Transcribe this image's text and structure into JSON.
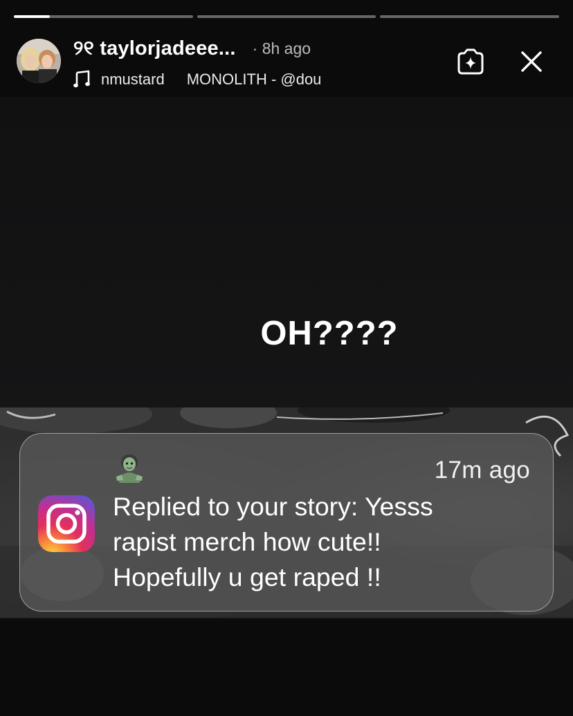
{
  "story": {
    "progress_segments": [
      {
        "fill_fraction": 0.2
      },
      {
        "fill_fraction": 0
      },
      {
        "fill_fraction": 0
      }
    ],
    "header": {
      "username": "୨୧ taylorjadeee...",
      "time_ago": "· 8h ago",
      "music": {
        "artist": "nmustard",
        "track": "MONOLITH - @dou"
      }
    },
    "text_overlay": "OH????"
  },
  "notification": {
    "app_icon": "instagram-icon",
    "sender_avatar": "zombie-emoji",
    "time": "17m ago",
    "body_lines": [
      "Replied to your story: Yesss",
      "rapist merch how cute!!",
      "Hopefully u get raped !!"
    ]
  },
  "icons": {
    "save": "sparkle-circle-icon",
    "close": "close-icon",
    "music": "music-note-icon"
  },
  "colors": {
    "background": "#0b0b0c",
    "progress_active": "#ffffff",
    "progress_inactive": "#6b6b6b",
    "notification_card": "#5c5c5c"
  }
}
